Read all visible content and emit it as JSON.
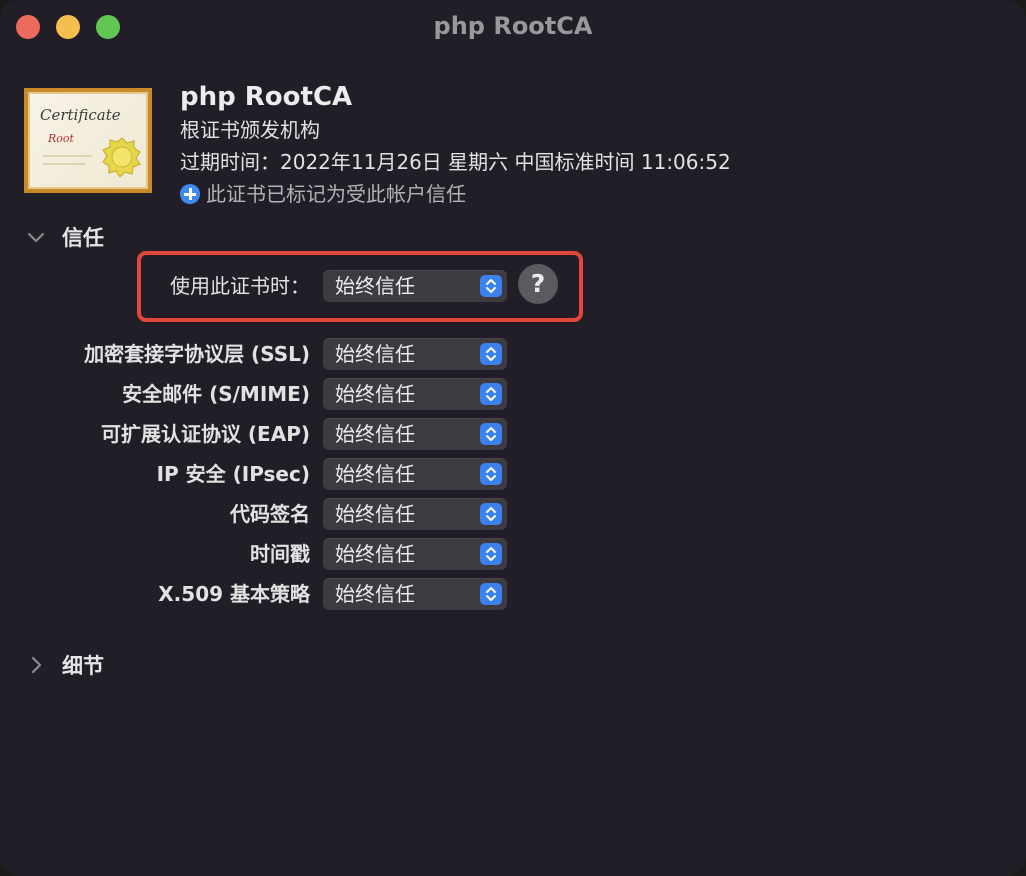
{
  "window": {
    "title": "php RootCA"
  },
  "certificate": {
    "icon_text_top": "Certificate",
    "icon_text_bottom": "Root",
    "name": "php RootCA",
    "type": "根证书颁发机构",
    "expiry": "过期时间：2022年11月26日 星期六 中国标准时间 11:06:52",
    "trust_note": "此证书已标记为受此帐户信任"
  },
  "trust": {
    "section_label": "信任",
    "when_using": {
      "label": "使用此证书时：",
      "value": "始终信任"
    },
    "help_label": "?",
    "rows": [
      {
        "label": "加密套接字协议层 (SSL)",
        "value": "始终信任"
      },
      {
        "label": "安全邮件 (S/MIME)",
        "value": "始终信任"
      },
      {
        "label": "可扩展认证协议 (EAP)",
        "value": "始终信任"
      },
      {
        "label": "IP 安全 (IPsec)",
        "value": "始终信任"
      },
      {
        "label": "代码签名",
        "value": "始终信任"
      },
      {
        "label": "时间戳",
        "value": "始终信任"
      },
      {
        "label": "X.509 基本策略",
        "value": "始终信任"
      }
    ]
  },
  "details": {
    "section_label": "细节"
  },
  "colors": {
    "background": "#221e27",
    "highlight": "#e0463a",
    "accent": "#3b82f0"
  }
}
